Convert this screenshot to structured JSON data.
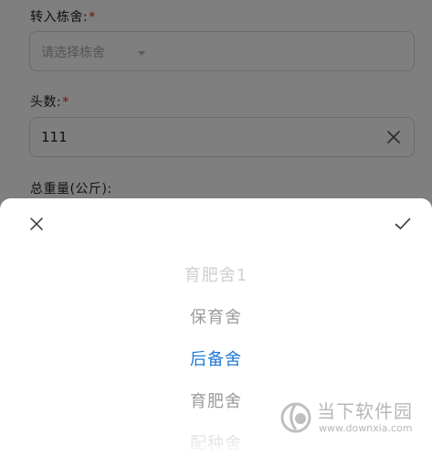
{
  "form": {
    "pen": {
      "label": "转入栋舍:",
      "required_mark": "*",
      "placeholder": "请选择栋舍"
    },
    "head_count": {
      "label": "头数:",
      "required_mark": "*",
      "value": "111"
    },
    "total_weight": {
      "label": "总重量(公斤):"
    }
  },
  "picker": {
    "options": [
      {
        "label": "育肥舍1"
      },
      {
        "label": "保育舍"
      },
      {
        "label": "后备舍"
      },
      {
        "label": "育肥舍"
      },
      {
        "label": "配种舍"
      }
    ],
    "selected_index": 2,
    "selected_color": "#1f79d3"
  },
  "watermark": {
    "name": "当下软件园",
    "url": "www.downxia.com"
  }
}
